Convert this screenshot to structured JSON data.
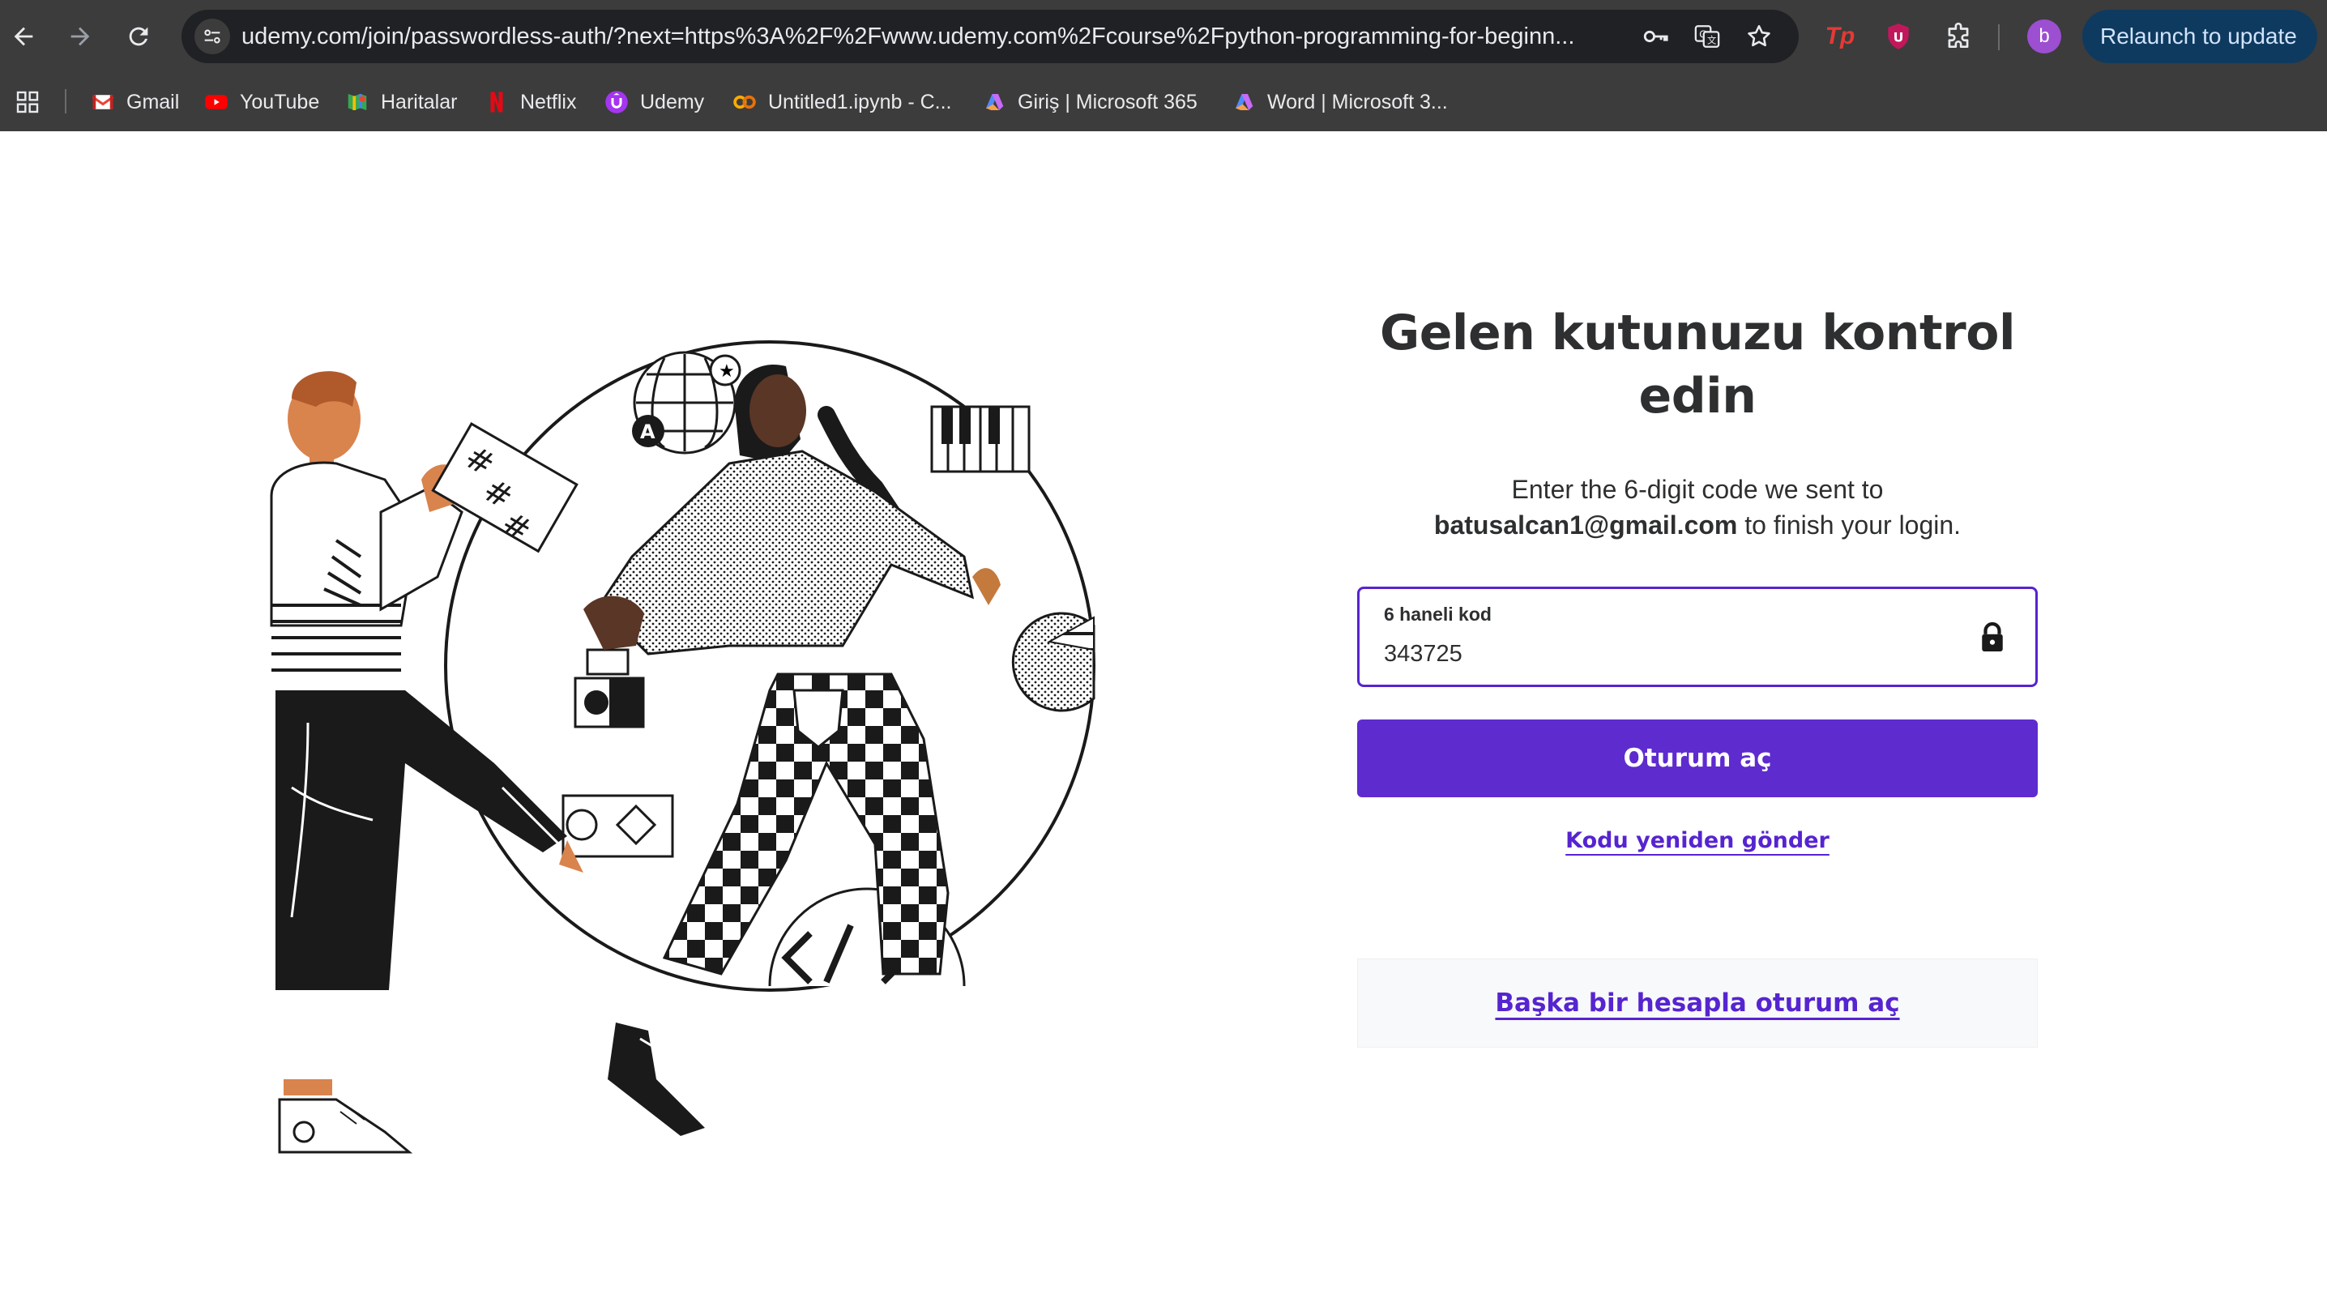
{
  "browser": {
    "url": "udemy.com/join/passwordless-auth/?next=https%3A%2F%2Fwww.udemy.com%2Fcourse%2Fpython-programming-for-beginn...",
    "relaunch_label": "Relaunch to update",
    "profile_initial": "b",
    "extensions": [
      "tp-icon",
      "ublock-icon",
      "puzzle-extensions-icon"
    ],
    "bookmarks": [
      {
        "label": "Gmail",
        "icon": "gmail-icon"
      },
      {
        "label": "YouTube",
        "icon": "youtube-icon"
      },
      {
        "label": "Haritalar",
        "icon": "maps-icon"
      },
      {
        "label": "Netflix",
        "icon": "netflix-icon"
      },
      {
        "label": "Udemy",
        "icon": "udemy-icon"
      },
      {
        "label": "Untitled1.ipynb - C...",
        "icon": "colab-icon"
      },
      {
        "label": "Giriş | Microsoft 365",
        "icon": "microsoft365-icon"
      },
      {
        "label": "Word | Microsoft 3...",
        "icon": "microsoft365-icon"
      }
    ]
  },
  "auth": {
    "title_line1": "Gelen kutunuzu kontrol",
    "title_line2": "edin",
    "message_prefix": "Enter the 6-digit code we sent to",
    "email": "batusalcan1@gmail.com",
    "message_suffix": "to finish your login.",
    "code_label": "6 haneli kod",
    "code_value": "343725",
    "submit_label": "Oturum aç",
    "resend_label": "Kodu yeniden gönder",
    "other_account_label": "Başka bir hesapla oturum aç"
  },
  "colors": {
    "brand_purple": "#5624d0",
    "button_purple": "#5e2bcf",
    "chrome_bg": "#3c3c3c",
    "omnibox_bg": "#202124"
  }
}
